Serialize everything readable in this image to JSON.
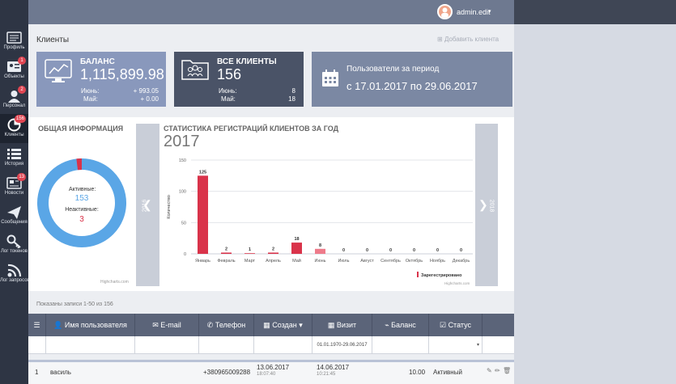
{
  "sidebar": {
    "items": [
      {
        "label": "Профиль",
        "icon": "profile-card-icon",
        "badge": ""
      },
      {
        "label": "Объекты",
        "icon": "objects-icon",
        "badge": "1"
      },
      {
        "label": "Персонал",
        "icon": "staff-icon",
        "badge": "2"
      },
      {
        "label": "Клиенты",
        "icon": "clients-icon",
        "badge": "156"
      },
      {
        "label": "История",
        "icon": "history-list-icon",
        "badge": ""
      },
      {
        "label": "Новости",
        "icon": "news-icon",
        "badge": "13"
      },
      {
        "label": "Сообщения",
        "icon": "send-icon",
        "badge": ""
      },
      {
        "label": "Лог токенов",
        "icon": "key-icon",
        "badge": ""
      },
      {
        "label": "Лог запросов",
        "icon": "rss-icon",
        "badge": ""
      }
    ]
  },
  "user": {
    "name": "admin.edit"
  },
  "page": {
    "title": "Клиенты",
    "add_client": "Добавить клиента"
  },
  "cards": {
    "balance": {
      "title": "БАЛАНС",
      "value": "1,115,899.98",
      "row1_label": "Июнь:",
      "row1_value": "+ 993.05",
      "row2_label": "Май:",
      "row2_value": "+ 0.00"
    },
    "clients": {
      "title": "ВСЕ КЛИЕНТЫ",
      "value": "156",
      "row1_label": "Июнь:",
      "row1_value": "8",
      "row2_label": "Май:",
      "row2_value": "18"
    },
    "period": {
      "title": "Пользователи за период",
      "range": "с 17.01.2017 по 29.06.2017"
    }
  },
  "general": {
    "title": "ОБЩАЯ ИНФОРМАЦИЯ",
    "active_label": "Активные:",
    "active_value": "153",
    "inactive_label": "Неактивные:",
    "inactive_value": "3",
    "credit": "Highcharts.com"
  },
  "stats": {
    "title": "СТАТИСТИКА РЕГИСТРАЦИЙ КЛИЕНТОВ ЗА ГОД",
    "year": "2017",
    "prev_year": "2016",
    "next_year": "2018",
    "credit": "Highcharts.com"
  },
  "chart_data": [
    {
      "type": "pie",
      "categories": [
        "Активные",
        "Неактивные"
      ],
      "values": [
        153,
        3
      ],
      "colors": [
        "#5aa6e6",
        "#d9334a"
      ]
    },
    {
      "type": "bar",
      "ylabel": "Количество",
      "ylim": [
        0,
        150
      ],
      "yticks": [
        "0",
        "50",
        "100",
        "150"
      ],
      "categories": [
        "Январь",
        "Февраль",
        "Март",
        "Апрель",
        "Май",
        "Июнь",
        "Июль",
        "Август",
        "Сентябрь",
        "Октябрь",
        "Ноябрь",
        "Декабрь"
      ],
      "series": [
        {
          "name": "Зарегестрировано",
          "values": [
            125,
            2,
            1,
            2,
            18,
            8,
            0,
            0,
            0,
            0,
            0,
            0
          ]
        }
      ],
      "color": "#d9334a",
      "legend": "bottom-right"
    }
  ],
  "table": {
    "summary": "Показаны записи 1-50 из 156",
    "headers": [
      "Имя пользователя",
      "E-mail",
      "Телефон",
      "Создан",
      "Визит",
      "Баланс",
      "Статус"
    ],
    "filter_visit": "01.01.1970-29.06.2017",
    "rows": [
      {
        "num": "1",
        "name": "василь",
        "email": "",
        "phone": "+380965009288",
        "created": "13.06.2017",
        "created_time": "18:07:40",
        "visit": "14.06.2017",
        "visit_time": "10:21:45",
        "balance": "10.00",
        "status": "Активный"
      }
    ]
  }
}
